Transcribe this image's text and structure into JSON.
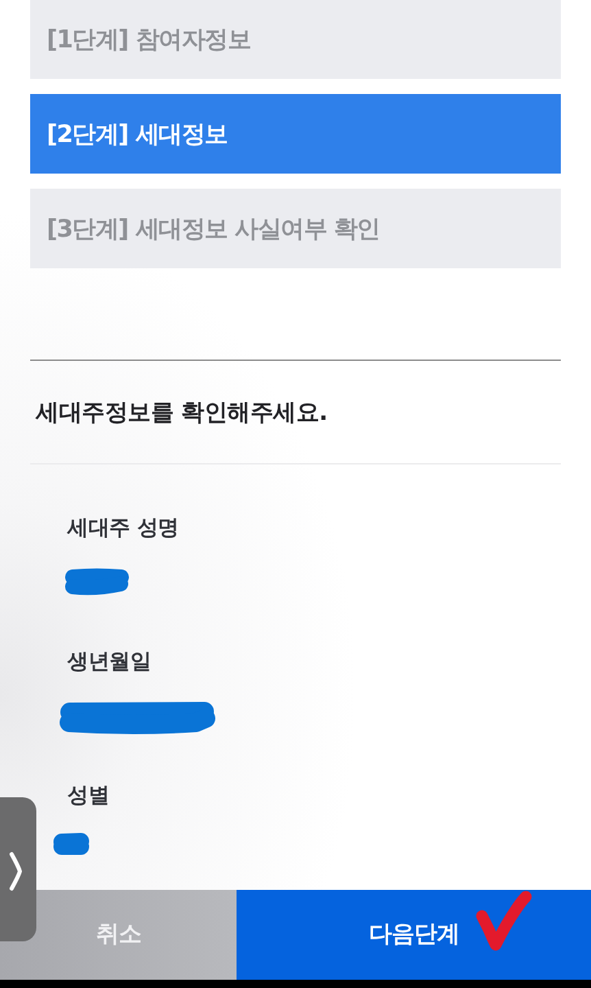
{
  "steps": [
    {
      "label": "[1단계] 참여자정보",
      "selected": false
    },
    {
      "label": "[2단계] 세대정보",
      "selected": true
    },
    {
      "label": "[3단계] 세대정보 사실여부 확인",
      "selected": false
    }
  ],
  "section": {
    "heading": "세대주정보를 확인해주세요.",
    "fields": [
      {
        "label": "세대주 성명",
        "redacted": true
      },
      {
        "label": "생년월일",
        "redacted": true
      },
      {
        "label": "성별",
        "redacted": true
      }
    ]
  },
  "buttons": [
    {
      "label": "취소",
      "kind": "secondary",
      "marked": false
    },
    {
      "label": "다음단계",
      "kind": "primary",
      "marked": true
    }
  ]
}
